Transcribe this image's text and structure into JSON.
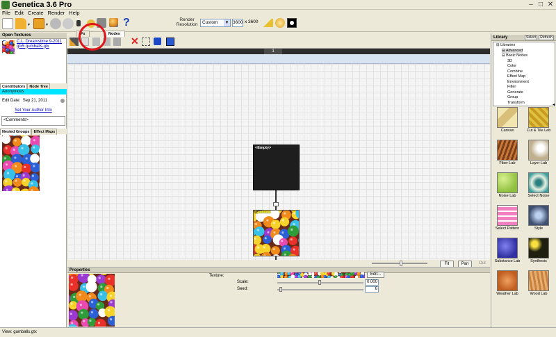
{
  "window": {
    "title": "Genetica 3.6 Pro",
    "minimize": "–",
    "maximize": "□",
    "close": "✕"
  },
  "menu": [
    "File",
    "Edit",
    "Create",
    "Render",
    "Help"
  ],
  "toolbar": {
    "render_label": "Render Resolution",
    "preset": "Custom",
    "width_value": "3600",
    "height_label": "x 3600"
  },
  "left_panel": {
    "open_textures_header": "Open Textures",
    "texture_credit": "C.L. Dreamstime 9-2011 gtx5 gumballs.gtx",
    "tab_contributors": "Contributors",
    "tab_node_tree": "Node Tree",
    "contributor": "Anonymous",
    "edit_date_label": "Edit Date:",
    "edit_date_value": "Sep 21, 2011",
    "author_link": "Set Your Author Info",
    "comments": "<Comments>",
    "tab_nested_groups": "Nested Groups",
    "tab_effect_maps": "Effect Maps"
  },
  "node_editor": {
    "tab_fx": "Fx",
    "tab_nodes": "Nodes",
    "ruler_label": "1",
    "empty_node_label": "<Empty>",
    "synth_node_label": "Synthesis",
    "fit_button": "Fit",
    "pan_button": "Pan",
    "out_button": "Out"
  },
  "properties": {
    "header": "Properties",
    "texture_label": "Texture:",
    "edit_button": "Edit...",
    "scale_label": "Scale:",
    "scale_value": "0.000",
    "seed_label": "Seed:",
    "seed_value": "6"
  },
  "library": {
    "header": "Library",
    "select_button": "Select",
    "refresh_button": "Refresh",
    "tree": [
      {
        "label": "Libraries",
        "indent": 0
      },
      {
        "label": "Advanced",
        "indent": 1,
        "selected": true
      },
      {
        "label": "Basic Nodes",
        "indent": 1
      },
      {
        "label": "3D",
        "indent": 2
      },
      {
        "label": "Color",
        "indent": 2
      },
      {
        "label": "Combine",
        "indent": 2
      },
      {
        "label": "Effect Map",
        "indent": 2
      },
      {
        "label": "Environment",
        "indent": 2
      },
      {
        "label": "Filter",
        "indent": 2
      },
      {
        "label": "Generate",
        "indent": 2
      },
      {
        "label": "Group",
        "indent": 2
      },
      {
        "label": "Transform",
        "indent": 2
      }
    ],
    "tiles": [
      "Canvas",
      "Cut & Tile Lab",
      "Fiber Lab",
      "Layer Lab",
      "Noise Lab",
      "Select Noise",
      "Select Pattern",
      "Style",
      "Substance Lab",
      "Synthesis",
      "Weather Lab",
      "Wood Lab"
    ]
  },
  "status": "View: gumballs.gtx",
  "colors": {
    "highlight": "#e0141a",
    "selection": "#00e5ff",
    "link": "#0000c0"
  }
}
